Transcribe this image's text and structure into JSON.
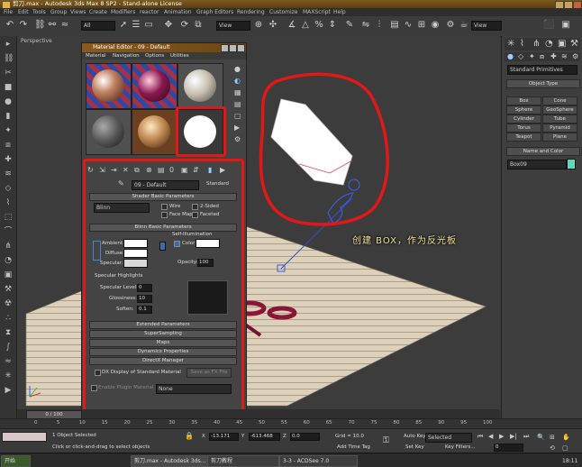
{
  "window": {
    "title": "剪刀.max - Autodesk 3ds Max 8 SP2 - Stand-alone License"
  },
  "menu": [
    "File",
    "Edit",
    "Tools",
    "Group",
    "Views",
    "Create",
    "Modifiers",
    "reactor",
    "Animation",
    "Graph Editors",
    "Rendering",
    "Customize",
    "MAXScript",
    "Help"
  ],
  "toolbar": {
    "filter_value": "All",
    "refcoord_value": "View",
    "refcoord2_value": "View"
  },
  "viewport": {
    "label": "Perspective",
    "annotation": "创建 BOX，作为反光板"
  },
  "command_panel": {
    "category": "Standard Primitives",
    "object_type_header": "Object Type",
    "buttons": [
      "Box",
      "Cone",
      "Sphere",
      "GeoSphere",
      "Cylinder",
      "Tube",
      "Torus",
      "Pyramid",
      "Teapot",
      "Plane"
    ],
    "name_color_header": "Name and Color",
    "object_name": "Box09",
    "object_color": "#5fd8b8"
  },
  "material_editor": {
    "title": "Material Editor - 09 - Default",
    "menu": [
      "Material",
      "Navigation",
      "Options",
      "Utilities"
    ],
    "material_name": "09 - Default",
    "material_type": "Standard",
    "shader_header": "Shader Basic Parameters",
    "shader": "Blinn",
    "wire": "Wire",
    "two_sided": "2-Sided",
    "face_map": "Face Map",
    "faceted": "Faceted",
    "blinn_header": "Blinn Basic Parameters",
    "self_illum": "Self-Illumination",
    "ambient": "Ambient:",
    "diffuse": "Diffuse:",
    "specular": "Specular:",
    "color_label": "Color",
    "opacity_label": "Opacity:",
    "opacity": "100",
    "spec_highlights": "Specular Highlights",
    "spec_level_label": "Specular Level:",
    "spec_level": "0",
    "glossiness_label": "Glossiness:",
    "glossiness": "10",
    "soften_label": "Soften:",
    "soften": "0.1",
    "rollouts": [
      "Extended Parameters",
      "SuperSampling",
      "Maps",
      "Dynamics Properties",
      "DirectX Manager"
    ],
    "dx_display": "DX Display of Standard Material",
    "save_fx": "Save as FX File",
    "enable_plugin": "Enable Plugin Material",
    "plugin_value": "None"
  },
  "timeline": {
    "frame": "0 / 100",
    "ticks": [
      "0",
      "5",
      "10",
      "15",
      "20",
      "25",
      "30",
      "35",
      "40",
      "45",
      "50",
      "55",
      "60",
      "65",
      "70",
      "75",
      "80",
      "85",
      "90",
      "95",
      "100"
    ]
  },
  "status": {
    "selection": "1 Object Selected",
    "prompt": "Click or click-and-drag to select objects",
    "x_label": "X",
    "x": "-13.171",
    "y_label": "Y",
    "y": "-613.468",
    "z_label": "Z",
    "z": "0.0",
    "grid": "Grid = 10.0",
    "add_time_tag": "Add Time Tag",
    "auto_key": "Auto Key",
    "set_key": "Set Key",
    "selected": "Selected",
    "key_filters": "Key Filters...",
    "current_frame": "0"
  },
  "taskbar": {
    "start": "开始",
    "tasks": [
      "剪刀.max - Autodesk 3ds...",
      "剪刀教程",
      "3-3 - ACDSee 7.0"
    ],
    "clock": "18:11"
  },
  "colors": {
    "highlight": "#e01818",
    "accent_teal": "#5fd8b8",
    "annotation": "#f5e59a"
  }
}
